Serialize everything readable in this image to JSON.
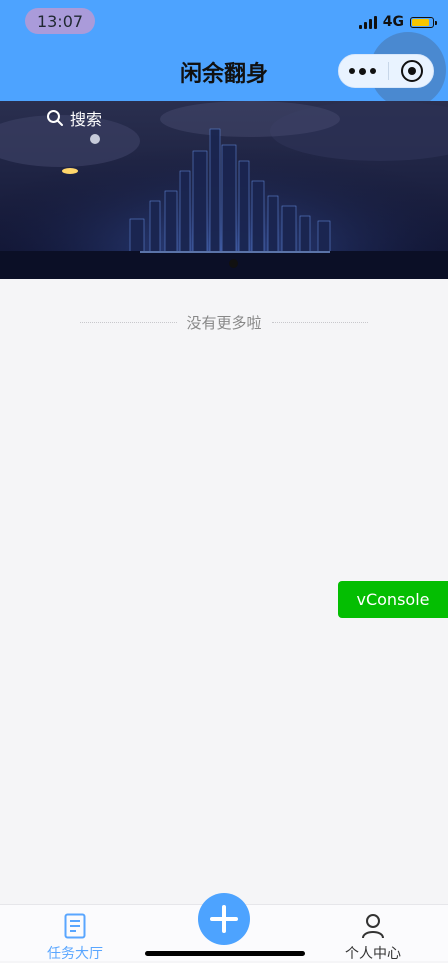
{
  "status_bar": {
    "time": "13:07",
    "network": "4G"
  },
  "nav": {
    "title": "闲余翻身"
  },
  "banner": {
    "search_label": "搜索"
  },
  "content": {
    "no_more_text": "没有更多啦"
  },
  "vconsole": {
    "label": "vConsole"
  },
  "tabbar": {
    "left_label": "任务大厅",
    "right_label": "个人中心"
  },
  "colors": {
    "primary": "#4da3ff",
    "vconsole": "#04be02",
    "tab_active": "#59a6ff"
  },
  "icons": {
    "left_tab": "document-list-icon",
    "right_tab": "user-icon",
    "add": "plus-icon",
    "search": "search-icon"
  }
}
